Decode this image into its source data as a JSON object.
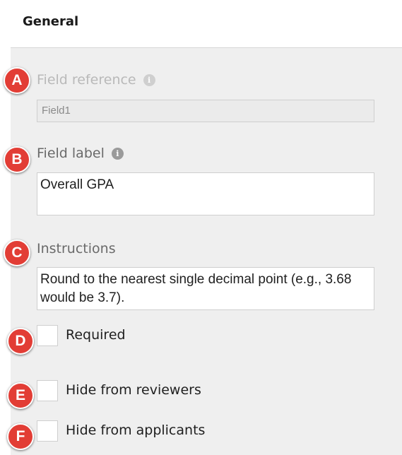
{
  "section": {
    "title": "General"
  },
  "field_reference": {
    "label": "Field reference",
    "value": "Field1",
    "info_icon": "info-icon"
  },
  "field_label": {
    "label": "Field label",
    "value": "Overall GPA",
    "info_icon": "info-icon"
  },
  "instructions": {
    "label": "Instructions",
    "value": "Round to the nearest single decimal point (e.g., 3.68 would be 3.7)."
  },
  "options": {
    "required": {
      "label": "Required",
      "checked": false
    },
    "hide_reviewers": {
      "label": "Hide from reviewers",
      "checked": false
    },
    "hide_applicants": {
      "label": "Hide from applicants",
      "checked": false
    }
  },
  "markers": [
    "A",
    "B",
    "C",
    "D",
    "E",
    "F"
  ],
  "colors": {
    "marker": "#e23d35",
    "panel_bg": "#efefef"
  }
}
